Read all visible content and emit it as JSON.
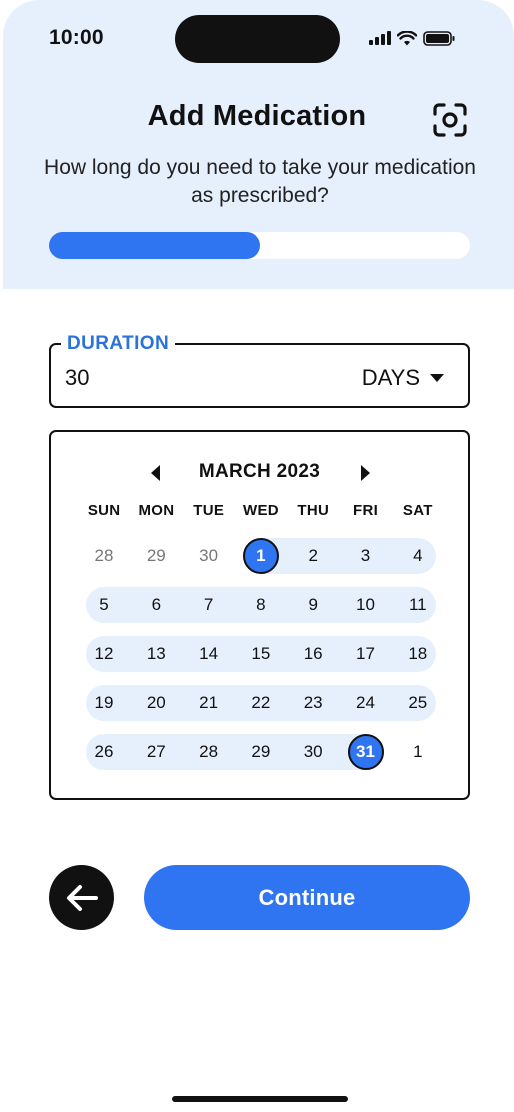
{
  "status_bar": {
    "time": "10:00",
    "icons": [
      "cellular-signal-icon",
      "wifi-icon",
      "battery-icon"
    ]
  },
  "header": {
    "title": "Add Medication",
    "subtitle": "How long do you need to take your medication as prescribed?",
    "scan_icon": "scan-icon",
    "progress": 0.5
  },
  "duration": {
    "label": "DURATION",
    "value": "30",
    "unit": "DAYS",
    "unit_icon": "caret-down-icon"
  },
  "calendar": {
    "month_label": "MARCH 2023",
    "prev_icon": "chevron-left-icon",
    "next_icon": "chevron-right-icon",
    "weekdays": [
      "SUN",
      "MON",
      "TUE",
      "WED",
      "THU",
      "FRI",
      "SAT"
    ],
    "weeks": [
      [
        {
          "d": "28",
          "muted": true
        },
        {
          "d": "29",
          "muted": true
        },
        {
          "d": "30",
          "muted": true
        },
        {
          "d": "1",
          "selected": true
        },
        {
          "d": "2"
        },
        {
          "d": "3"
        },
        {
          "d": "4"
        }
      ],
      [
        {
          "d": "5"
        },
        {
          "d": "6"
        },
        {
          "d": "7"
        },
        {
          "d": "8"
        },
        {
          "d": "9"
        },
        {
          "d": "10"
        },
        {
          "d": "11"
        }
      ],
      [
        {
          "d": "12"
        },
        {
          "d": "13"
        },
        {
          "d": "14"
        },
        {
          "d": "15"
        },
        {
          "d": "16"
        },
        {
          "d": "17"
        },
        {
          "d": "18"
        }
      ],
      [
        {
          "d": "19"
        },
        {
          "d": "20"
        },
        {
          "d": "21"
        },
        {
          "d": "22"
        },
        {
          "d": "23"
        },
        {
          "d": "24"
        },
        {
          "d": "25"
        }
      ],
      [
        {
          "d": "26"
        },
        {
          "d": "27"
        },
        {
          "d": "28"
        },
        {
          "d": "29"
        },
        {
          "d": "30"
        },
        {
          "d": "31",
          "selected": true
        },
        {
          "d": "1"
        }
      ]
    ],
    "range_start": "March 1, 2023",
    "range_end": "March 31, 2023"
  },
  "actions": {
    "back_icon": "arrow-left-icon",
    "continue_label": "Continue"
  },
  "colors": {
    "accent": "#2f74f0",
    "header_bg": "#e6f0fd",
    "label_blue": "#2a73d9",
    "dark": "#111111"
  }
}
